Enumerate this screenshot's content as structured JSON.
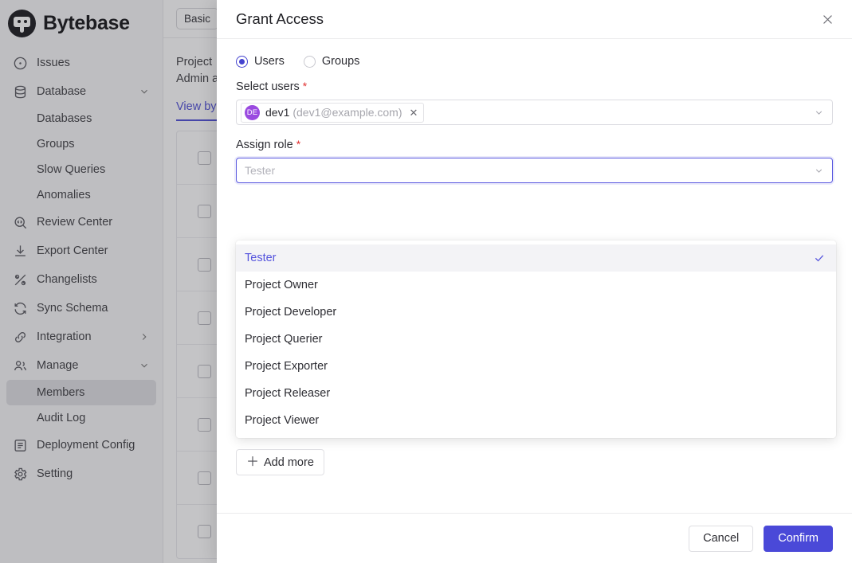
{
  "app": {
    "brand": "Bytebase",
    "sidebar": {
      "items": [
        {
          "label": "Issues",
          "icon": "issues-icon",
          "type": "item"
        },
        {
          "label": "Database",
          "icon": "database-icon",
          "type": "item",
          "chevron": "chevron-down-icon"
        },
        {
          "label": "Databases",
          "type": "sub"
        },
        {
          "label": "Groups",
          "type": "sub"
        },
        {
          "label": "Slow Queries",
          "type": "sub"
        },
        {
          "label": "Anomalies",
          "type": "sub"
        },
        {
          "label": "Review Center",
          "icon": "review-center-icon",
          "type": "item"
        },
        {
          "label": "Export Center",
          "icon": "export-center-icon",
          "type": "item"
        },
        {
          "label": "Changelists",
          "icon": "changelists-icon",
          "type": "item"
        },
        {
          "label": "Sync Schema",
          "icon": "sync-schema-icon",
          "type": "item"
        },
        {
          "label": "Integration",
          "icon": "integration-icon",
          "type": "item",
          "chevron": "chevron-right-icon"
        },
        {
          "label": "Manage",
          "icon": "manage-icon",
          "type": "item",
          "chevron": "chevron-down-icon"
        },
        {
          "label": "Members",
          "type": "sub",
          "active": true
        },
        {
          "label": "Audit Log",
          "type": "sub"
        },
        {
          "label": "Deployment Config",
          "icon": "deployment-config-icon",
          "type": "item"
        },
        {
          "label": "Setting",
          "icon": "setting-icon",
          "type": "item"
        }
      ]
    },
    "topbar": {
      "mode_button": "Basic"
    },
    "page": {
      "line1": "Project",
      "line2": "Admin a",
      "tab": "View by"
    },
    "table": {
      "row_count": 8
    }
  },
  "modal": {
    "title": "Grant Access",
    "close_icon": "close-icon",
    "principal_type": {
      "options": [
        {
          "label": "Users",
          "selected": true
        },
        {
          "label": "Groups",
          "selected": false
        }
      ]
    },
    "select_users": {
      "label": "Select users",
      "required_marker": "*",
      "caret_icon": "chevron-down-icon",
      "tags": [
        {
          "initials": "DE",
          "name": "dev1",
          "email": "(dev1@example.com)",
          "remove_icon": "close-icon"
        }
      ]
    },
    "assign_role": {
      "label": "Assign role",
      "required_marker": "*",
      "placeholder": "Tester",
      "value": "",
      "caret_icon": "chevron-down-icon",
      "focused": true,
      "options": [
        {
          "label": "Tester",
          "selected": true
        },
        {
          "label": "Project Owner",
          "selected": false
        },
        {
          "label": "Project Developer",
          "selected": false
        },
        {
          "label": "Project Querier",
          "selected": false
        },
        {
          "label": "Project Exporter",
          "selected": false
        },
        {
          "label": "Project Releaser",
          "selected": false
        },
        {
          "label": "Project Viewer",
          "selected": false
        }
      ],
      "check_icon": "check-icon"
    },
    "add_more": {
      "label": "Add more",
      "icon": "plus-icon"
    },
    "footer": {
      "cancel_label": "Cancel",
      "confirm_label": "Confirm"
    }
  },
  "colors": {
    "accent": "#4a49d8",
    "accent_text": "#5453dd",
    "avatar": "#9a4ae0",
    "required": "#e03131",
    "tab_underline": "#4b4bd6"
  }
}
